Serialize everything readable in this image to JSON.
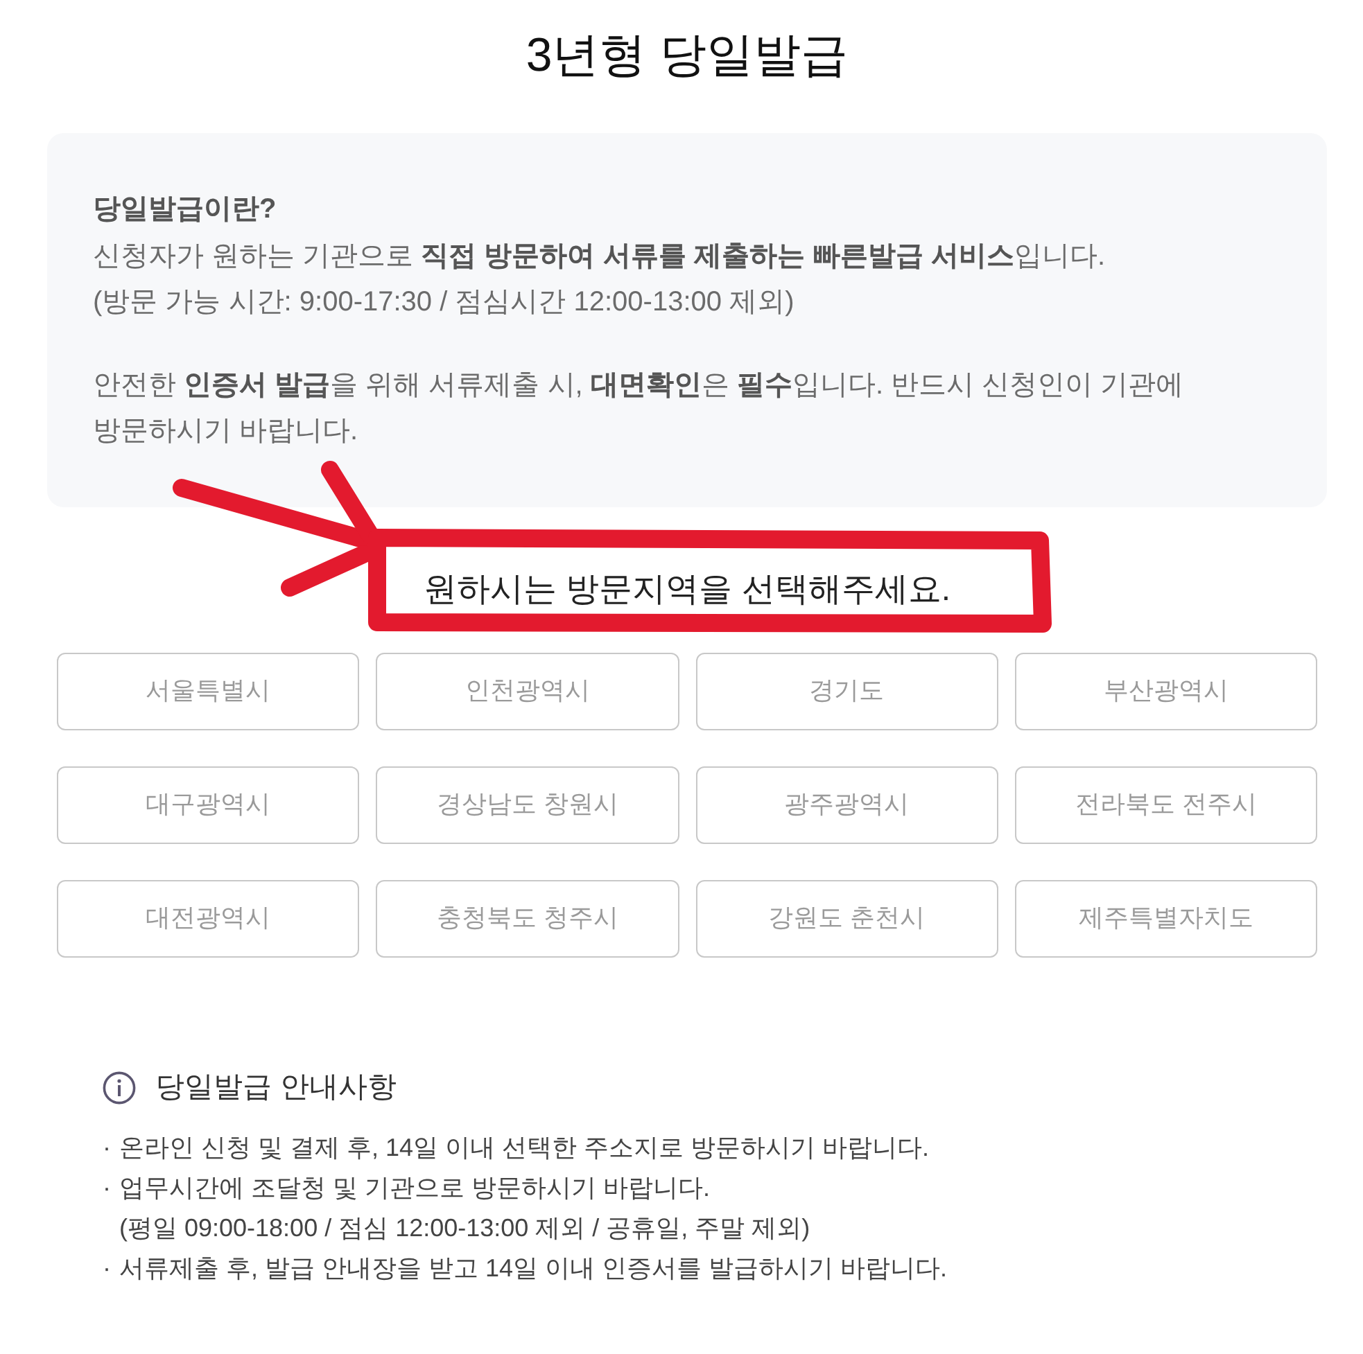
{
  "title": "3년형 당일발급",
  "intro": {
    "heading": "당일발급이란?",
    "lines": [
      "신청자가 원하는 기관으로 **직접 방문하여 서류를 제출하는 빠른발급 서비스**입니다.",
      "(방문 가능 시간: 9:00-17:30 / 점심시간 12:00-13:00 제외)"
    ],
    "paragraph": "안전한 **인증서 발급**을 위해 서류제출 시, **대면확인**은 **필수**입니다. 반드시 신청인이 기관에 방문하시기 바랍니다."
  },
  "prompt": {
    "text": "원하시는 방문지역을 선택해주세요.",
    "highlighted": true
  },
  "regions": [
    {
      "label": "서울특별시",
      "selected": false
    },
    {
      "label": "인천광역시",
      "selected": false
    },
    {
      "label": "경기도",
      "selected": false
    },
    {
      "label": "부산광역시",
      "selected": false
    },
    {
      "label": "대구광역시",
      "selected": false
    },
    {
      "label": "경상남도 창원시",
      "selected": false
    },
    {
      "label": "광주광역시",
      "selected": false
    },
    {
      "label": "전라북도 전주시",
      "selected": false
    },
    {
      "label": "대전광역시",
      "selected": false
    },
    {
      "label": "충청북도 청주시",
      "selected": false
    },
    {
      "label": "강원도 춘천시",
      "selected": false
    },
    {
      "label": "제주특별자치도",
      "selected": false
    }
  ],
  "notice": {
    "title": "당일발급 안내사항",
    "bullet": "·",
    "items": [
      {
        "text": "온라인 신청 및 결제 후, 14일 이내 선택한 주소지로 방문하시기 바랍니다."
      },
      {
        "text": "업무시간에 조달청 및 기관으로 방문하시기 바랍니다.",
        "note": "(평일 09:00-18:00 / 점심 12:00-13:00 제외 / 공휴일, 주말 제외)"
      },
      {
        "text": "서류제출 후, 발급 안내장을 받고 14일 이내 인증서를 발급하시기 바랍니다."
      }
    ]
  }
}
